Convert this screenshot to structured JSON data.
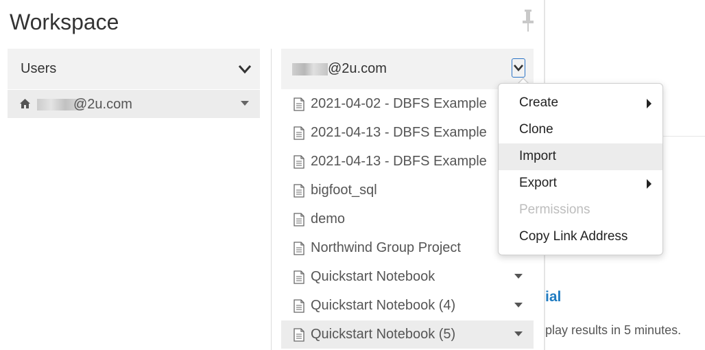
{
  "background": {
    "link_fragment": "ial",
    "text_fragment": "play results in 5 minutes."
  },
  "workspace": {
    "title": "Workspace",
    "left": {
      "header": "Users",
      "home_item": "@2u.com"
    },
    "right": {
      "header": "@2u.com",
      "files": [
        {
          "label": "2021-04-02 - DBFS Example",
          "icon": "notebook-icon"
        },
        {
          "label": "2021-04-13 - DBFS Example",
          "icon": "notebook-icon"
        },
        {
          "label": "2021-04-13 - DBFS Example",
          "icon": "notebook-icon"
        },
        {
          "label": "bigfoot_sql",
          "icon": "notebook-icon"
        },
        {
          "label": "demo",
          "icon": "notebook-icon"
        },
        {
          "label": "Northwind Group Project",
          "icon": "notebook-icon"
        },
        {
          "label": "Quickstart Notebook",
          "icon": "notebook-icon"
        },
        {
          "label": "Quickstart Notebook (4)",
          "icon": "notebook-icon"
        },
        {
          "label": "Quickstart Notebook (5)",
          "icon": "notebook-icon"
        }
      ]
    }
  },
  "context_menu": {
    "items": [
      {
        "label": "Create",
        "submenu": true,
        "enabled": true
      },
      {
        "label": "Clone",
        "submenu": false,
        "enabled": true
      },
      {
        "label": "Import",
        "submenu": false,
        "enabled": true,
        "highlighted": true
      },
      {
        "label": "Export",
        "submenu": true,
        "enabled": true
      },
      {
        "label": "Permissions",
        "submenu": false,
        "enabled": false
      },
      {
        "label": "Copy Link Address",
        "submenu": false,
        "enabled": true
      }
    ]
  },
  "colors": {
    "accent": "#2a73c6",
    "link": "#1f7bc1",
    "header_bg": "#f2f2f2",
    "selected_bg": "#ececec"
  }
}
